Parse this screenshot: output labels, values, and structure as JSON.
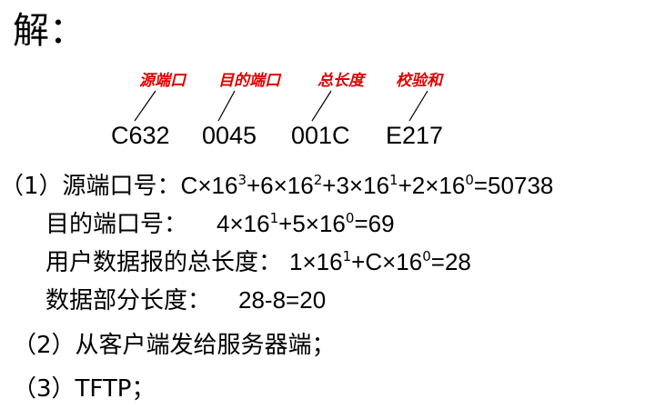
{
  "heading": "解：",
  "labels": {
    "src_port": "源端口",
    "dst_port": "目的端口",
    "total_len": "总长度",
    "checksum": "校验和"
  },
  "hex_fields": {
    "src_port": "C632",
    "dst_port": "0045",
    "total_len": "001C",
    "checksum": "E217"
  },
  "lines": {
    "l1_prefix": "（1）源端口号：",
    "l1_a": "C×16",
    "l1_a_exp": "3",
    "l1_b": "+6×16",
    "l1_b_exp": "2",
    "l1_c": "+3×16",
    "l1_c_exp": "1",
    "l1_d": "+2×16",
    "l1_d_exp": "0",
    "l1_result": "=50738",
    "l2_prefix": "目的端口号：",
    "l2_a": "4×16",
    "l2_a_exp": "1",
    "l2_b": "+5×16",
    "l2_b_exp": "0",
    "l2_result": "=69",
    "l3_prefix": "用户数据报的总长度：",
    "l3_a": "1×16",
    "l3_a_exp": "1",
    "l3_b": "+C×16",
    "l3_b_exp": "0",
    "l3_result": "=28",
    "l4_prefix": "数据部分长度：",
    "l4_expr": "28-8=20",
    "l5": "（2）从客户端发给服务器端；",
    "l6": "（3）TFTP；"
  },
  "colors": {
    "label_red": "#e00000",
    "text": "#000000"
  }
}
